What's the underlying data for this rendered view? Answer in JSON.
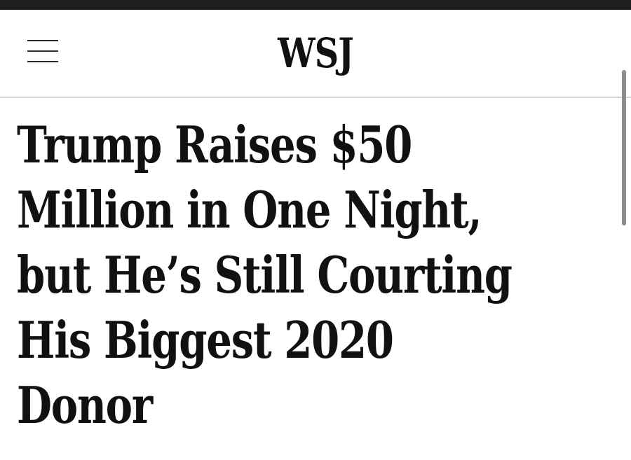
{
  "header": {
    "logo_text": "WSJ",
    "menu_icon": "hamburger-menu-icon"
  },
  "article": {
    "headline_lines": [
      "Trump Raises $50",
      "Million in One Night,",
      "but He’s Still Courting",
      "His Biggest 2020",
      "Donor"
    ]
  },
  "colors": {
    "top_strip": "#1e1e1e",
    "text": "#111111",
    "divider": "#d4d4d4",
    "scrollbar": "#8d8d8d",
    "background": "#ffffff"
  }
}
